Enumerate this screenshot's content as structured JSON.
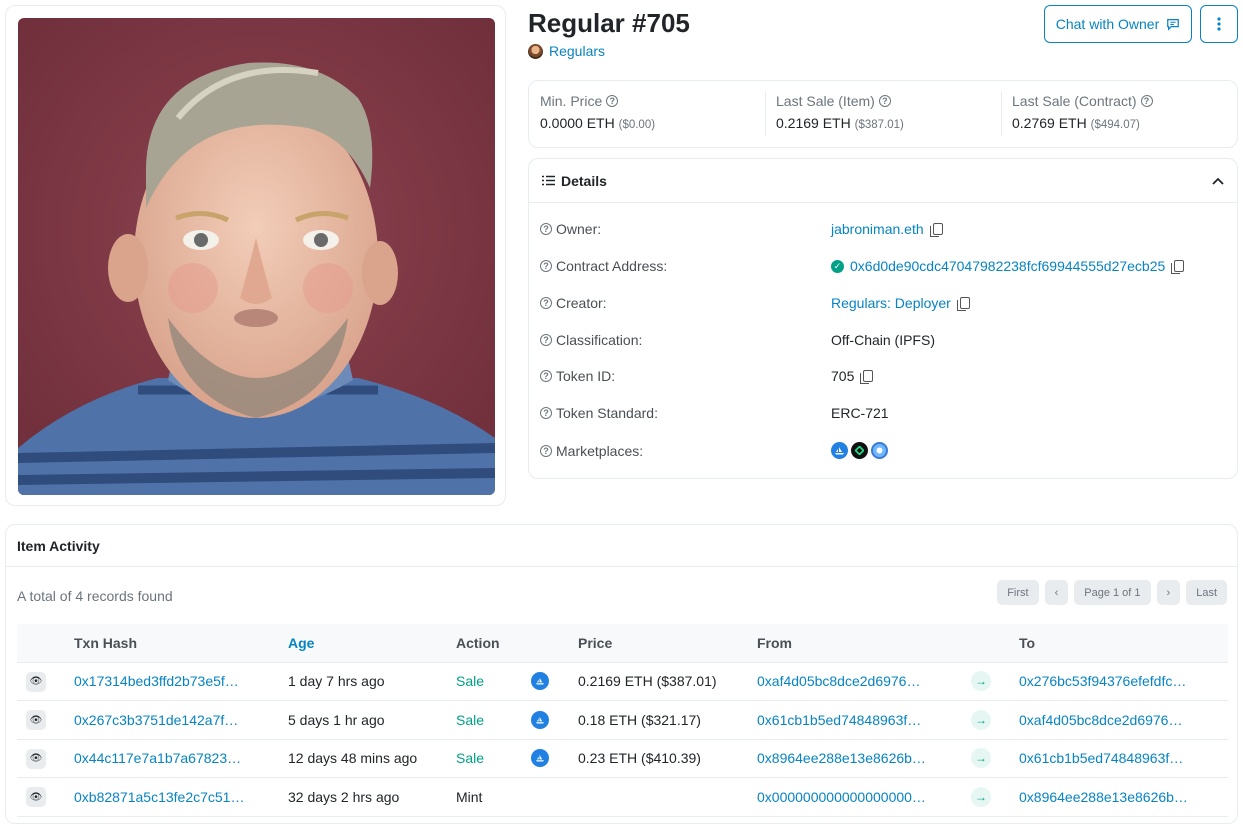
{
  "nft": {
    "title": "Regular #705",
    "collection": "Regulars"
  },
  "actions": {
    "chat_label": "Chat with Owner"
  },
  "stats": [
    {
      "label": "Min. Price",
      "value": "0.0000 ETH",
      "usd": "($0.00)"
    },
    {
      "label": "Last Sale (Item)",
      "value": "0.2169 ETH",
      "usd": "($387.01)"
    },
    {
      "label": "Last Sale (Contract)",
      "value": "0.2769 ETH",
      "usd": "($494.07)"
    }
  ],
  "details": {
    "heading": "Details",
    "rows": [
      {
        "label": "Owner:",
        "value": "jabroniman.eth"
      },
      {
        "label": "Contract Address:",
        "value": "0x6d0de90cdc47047982238fcf69944555d27ecb25"
      },
      {
        "label": "Creator:",
        "value": "Regulars: Deployer"
      },
      {
        "label": "Classification:",
        "value": "Off-Chain (IPFS)"
      },
      {
        "label": "Token ID:",
        "value": "705"
      },
      {
        "label": "Token Standard:",
        "value": "ERC-721"
      },
      {
        "label": "Marketplaces:",
        "value": ""
      }
    ],
    "marketplaces": [
      "opensea-icon",
      "magic-eden-icon",
      "blur-icon"
    ]
  },
  "activity": {
    "heading": "Item Activity",
    "records": "A total of 4 records found",
    "pager": {
      "first": "First",
      "page": "Page 1 of 1",
      "last": "Last"
    },
    "columns": {
      "txn": "Txn Hash",
      "age": "Age",
      "action": "Action",
      "price": "Price",
      "from": "From",
      "to": "To"
    },
    "rows": [
      {
        "txn": "0x17314bed3ffd2b73e5f…",
        "age": "1 day 7 hrs ago",
        "action": "Sale",
        "price": "0.2169 ETH ($387.01)",
        "from": "0xaf4d05bc8dce2d6976…",
        "to": "0x276bc53f94376efefdfc…"
      },
      {
        "txn": "0x267c3b3751de142a7f…",
        "age": "5 days 1 hr ago",
        "action": "Sale",
        "price": "0.18 ETH ($321.17)",
        "from": "0x61cb1b5ed74848963f…",
        "to": "0xaf4d05bc8dce2d6976…"
      },
      {
        "txn": "0x44c117e7a1b7a67823…",
        "age": "12 days 48 mins ago",
        "action": "Sale",
        "price": "0.23 ETH ($410.39)",
        "from": "0x8964ee288e13e8626b…",
        "to": "0x61cb1b5ed74848963f…"
      },
      {
        "txn": "0xb82871a5c13fe2c7c51…",
        "age": "32 days 2 hrs ago",
        "action": "Mint",
        "price": "",
        "from": "0x000000000000000000…",
        "to": "0x8964ee288e13e8626b…"
      }
    ]
  },
  "colors": {
    "link": "#0784c3",
    "success": "#00a186",
    "border": "#e9ecef",
    "image_bg": "#7a3443"
  }
}
